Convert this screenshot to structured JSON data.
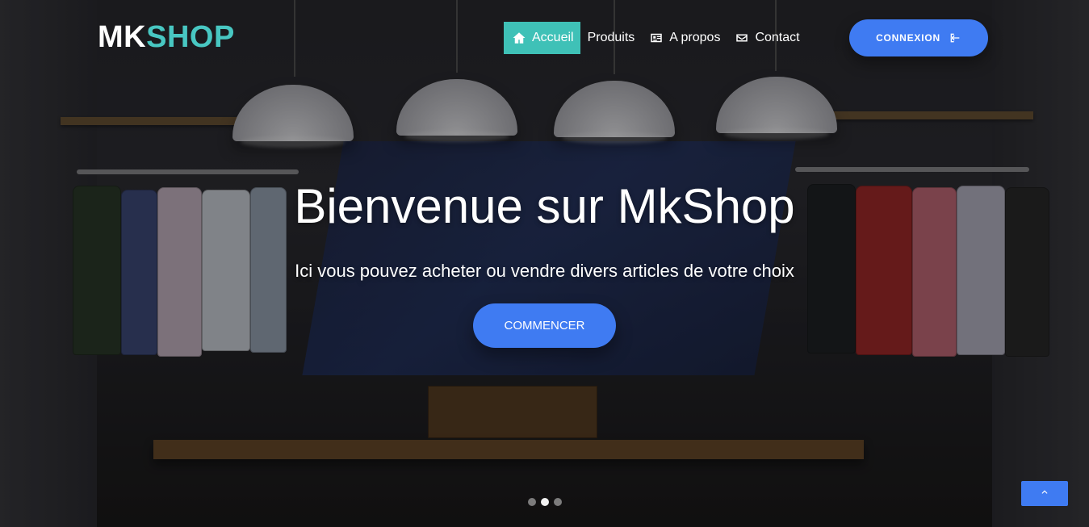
{
  "brand": {
    "part1": "MK",
    "part2": "SHOP"
  },
  "nav": {
    "items": [
      {
        "label": "Accueil",
        "icon": "home-icon",
        "active": true
      },
      {
        "label": "Produits",
        "icon": "",
        "active": false
      },
      {
        "label": "A propos",
        "icon": "id-card-icon",
        "active": false
      },
      {
        "label": "Contact",
        "icon": "envelope-icon",
        "active": false
      }
    ]
  },
  "auth": {
    "login_label": "CONNEXION",
    "login_icon": "sign-in-icon"
  },
  "hero": {
    "title": "Bienvenue sur MkShop",
    "subtitle": "Ici vous pouvez acheter ou vendre divers articles de votre choix",
    "cta_label": "COMMENCER"
  },
  "carousel": {
    "active_index": 1,
    "count": 3
  },
  "back_to_top": {
    "icon": "chevron-up-icon"
  },
  "colors": {
    "accent_teal": "#3fc1b7",
    "brand_teal": "#48c7c2",
    "primary_blue": "#3f7bf2",
    "text_white": "#ffffff"
  }
}
